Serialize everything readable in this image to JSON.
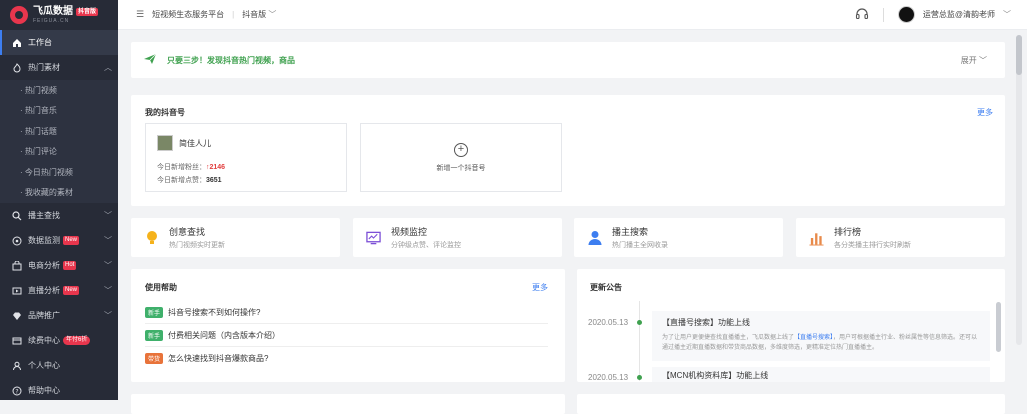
{
  "brand": {
    "name": "飞瓜数据",
    "badge": "抖音版",
    "sub": "FEIGUA.CN"
  },
  "sidebar": {
    "items": [
      {
        "label": "工作台"
      },
      {
        "label": "热门素材"
      },
      {
        "label": "播主查找"
      },
      {
        "label": "数据监测",
        "tag": "New"
      },
      {
        "label": "电商分析",
        "tag": "Hot"
      },
      {
        "label": "直播分析",
        "tag": "New"
      },
      {
        "label": "品牌推广"
      },
      {
        "label": "续费中心",
        "tag": "年付6折"
      },
      {
        "label": "个人中心"
      },
      {
        "label": "帮助中心"
      }
    ],
    "subitems": [
      "· 热门视频",
      "· 热门音乐",
      "· 热门话题",
      "· 热门评论",
      "· 今日热门视频",
      "· 我收藏的素材"
    ]
  },
  "topbar": {
    "menu_icon": "☰",
    "platform": "短视频生态服务平台",
    "sep": "|",
    "version": "抖音版",
    "user": "运营总监@清韵老师"
  },
  "alert": {
    "text": "只要三步！发现抖音热门视频，商品",
    "expand": "展开"
  },
  "douyin": {
    "title": "我的抖音号",
    "more": "更多",
    "account": {
      "name": "简佳人儿",
      "fans_label": "今日新增粉丝：",
      "fans_value": "↑2146",
      "likes_label": "今日新增点赞：",
      "likes_value": "3651"
    },
    "add_label": "新增一个抖音号"
  },
  "features": [
    {
      "title": "创意查找",
      "sub": "热门视频实时更新"
    },
    {
      "title": "视频监控",
      "sub": "分钟级点赞、评论监控"
    },
    {
      "title": "播主搜索",
      "sub": "热门播主全网收录"
    },
    {
      "title": "排行榜",
      "sub": "各分类播主排行实时刷新"
    }
  ],
  "help": {
    "title": "使用帮助",
    "more": "更多",
    "rows": [
      {
        "tag": "新手",
        "text": "抖音号搜索不到如何操作?"
      },
      {
        "tag": "新手",
        "text": "付费相关问题（内含版本介绍）"
      },
      {
        "tag": "带货",
        "text": "怎么快速找到抖音爆款商品?"
      }
    ]
  },
  "notice": {
    "title": "更新公告",
    "items": [
      {
        "date": "2020.05.13",
        "title": "【直播号搜索】功能上线",
        "body_1": "为了让用户更便捷查找直播播主，飞瓜数据上线了",
        "body_link": "【直播号搜索】",
        "body_2": "，用户可根据播主行业、粉丝属性等信息筛选。还可以通过播主近期直播数据和带货商品数据，多维度筛选，更精准定位热门直播播主。"
      },
      {
        "date": "2020.05.13",
        "title": "【MCN机构资料库】功能上线"
      }
    ]
  },
  "colors": {
    "sidebar": "#272b37",
    "accent": "#3d7ef0",
    "green": "#3fa14f",
    "red": "#e8364d"
  }
}
